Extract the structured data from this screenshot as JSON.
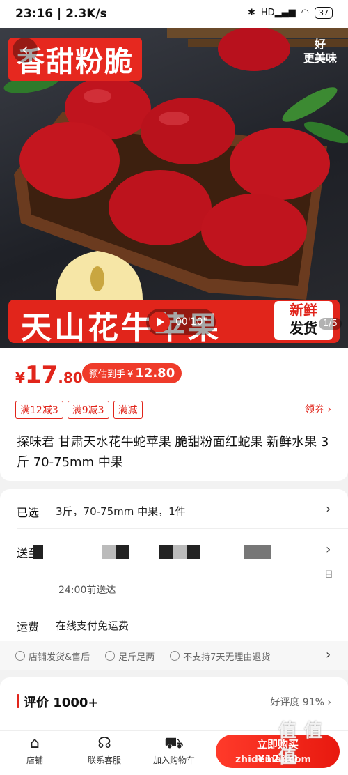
{
  "status_bar": {
    "time": "23:16",
    "speed": "2.3K/s",
    "signal": "HD",
    "battery": "37"
  },
  "hero": {
    "top_banner": "香甜粉脆",
    "brand_mark_line1": "好",
    "brand_mark_line2": "更美味",
    "title": "天山花牛苹果",
    "fresh_top": "新鲜",
    "fresh_bottom": "发货",
    "video_time": "00'10\"",
    "page_indicator": "1/5"
  },
  "price": {
    "currency": "¥",
    "integer": "17",
    "decimal": ".80",
    "estimate_label": "预估到手",
    "estimate_currency": "¥",
    "estimate_value": "12.80"
  },
  "coupons": [
    "满12减3",
    "满9减3",
    "满减"
  ],
  "claim_label": "领券 ›",
  "product_title": "探味君 甘肃天水花牛蛇苹果 脆甜粉面红蛇果 新鲜水果 3斤 70-75mm 中果",
  "spec": {
    "selected_label": "已选",
    "selected_value": "3斤，70-75mm 中果，1件",
    "ship_label": "送至",
    "ship_time": "24:00前送达",
    "ship_suffix": "日",
    "fee_label": "运费",
    "fee_value": "在线支付免运费"
  },
  "guarantees": [
    "店铺发货&售后",
    "足斤足两",
    "不支持7天无理由退货"
  ],
  "reviews": {
    "title": "评价",
    "count": "1000+",
    "rate": "好评度 91%"
  },
  "bottom_nav": {
    "shop": "店铺",
    "service": "联系客服",
    "cart": "加入购物车",
    "buy_label": "立即购买",
    "buy_price": "¥12.80"
  },
  "watermark": {
    "main": "值 值 值",
    "site": "zhidemai.com"
  },
  "colors": {
    "accent": "#e1251b",
    "estimate_pill": "#ef3b2a"
  }
}
